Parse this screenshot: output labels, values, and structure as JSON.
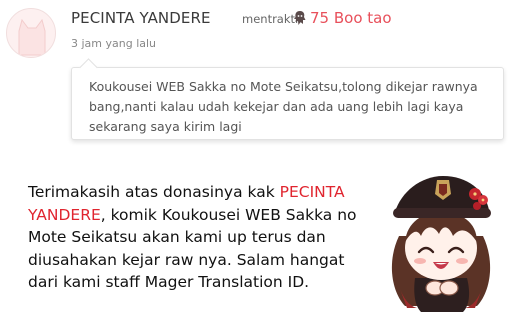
{
  "post": {
    "author": "PECINTA YANDERE",
    "verb": "mentraktir",
    "boo_icon": "boo-ghost-icon",
    "boo_amount": "75 Boo tao",
    "time": "3 jam yang lalu",
    "message": "Koukousei WEB Sakka no Mote Seikatsu,tolong dikejar rawnya bang,nanti kalau udah kekejar dan ada uang lebih lagi kaya sekarang saya kirim lagi"
  },
  "thanks": {
    "part1": "Terimakasih atas donasinya kak ",
    "highlight": "PECINTA YANDERE",
    "part2": ", komik Koukousei WEB Sakka no Mote Seikatsu akan kami up terus dan diusahakan kejar raw nya. Salam hangat dari kami staff Mager Translation ID."
  },
  "colors": {
    "highlight": "#e0252f",
    "boo": "#e8505b"
  },
  "icons": {
    "avatar": "default-cat-avatar-icon",
    "mascot": "chibi-character-sticker"
  }
}
